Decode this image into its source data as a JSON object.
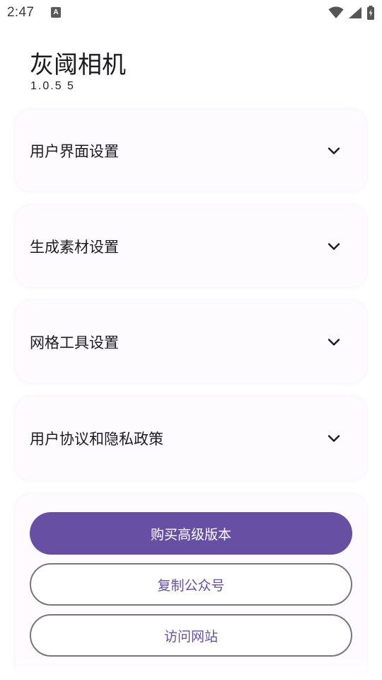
{
  "status_bar": {
    "time": "2:47",
    "notification_letter": "A",
    "icons": [
      "wifi-icon",
      "signal-icon",
      "battery-icon"
    ]
  },
  "header": {
    "title": "灰阈相机",
    "version": "1.0.5 5"
  },
  "sections": [
    {
      "label": "用户界面设置",
      "icon": "chevron-down-icon"
    },
    {
      "label": "生成素材设置",
      "icon": "chevron-down-icon"
    },
    {
      "label": "网格工具设置",
      "icon": "chevron-down-icon"
    },
    {
      "label": "用户协议和隐私政策",
      "icon": "chevron-down-icon"
    }
  ],
  "actions": {
    "buy_premium": "购买高级版本",
    "copy_account": "复制公众号",
    "visit_site": "访问网站"
  },
  "colors": {
    "primary": "#6750a4",
    "outline": "#79747e",
    "card_bg": "#fefbff"
  }
}
